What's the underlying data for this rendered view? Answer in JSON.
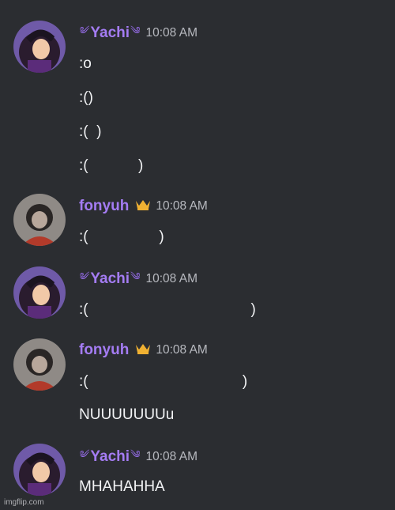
{
  "messages": [
    {
      "author": "Yachi",
      "author_type": "yachi",
      "decor_left": "༄",
      "decor_right": "༄",
      "time": "10:08 AM",
      "lines": [
        ":o",
        ":()",
        ":(  )",
        ":(            )"
      ]
    },
    {
      "author": "fonyuh",
      "author_type": "fonyuh",
      "time": "10:08 AM",
      "lines": [
        ":(                 )"
      ]
    },
    {
      "author": "Yachi",
      "author_type": "yachi",
      "decor_left": "༄",
      "decor_right": "༄",
      "time": "10:08 AM",
      "lines": [
        ":(                                       )"
      ]
    },
    {
      "author": "fonyuh",
      "author_type": "fonyuh",
      "time": "10:08 AM",
      "lines": [
        ":(                                     )",
        "NUUUUUUUu"
      ]
    },
    {
      "author": "Yachi",
      "author_type": "yachi",
      "decor_left": "༄",
      "decor_right": "༄",
      "time": "10:08 AM",
      "lines": [
        "MHAHAHHA"
      ]
    }
  ],
  "icons": {
    "crown": "crown-icon",
    "decor": "swirl-decoration-icon"
  },
  "colors": {
    "background": "#2b2d31",
    "username": "#a47cf3",
    "crown": "#f0b132",
    "timestamp": "#b7b9bf",
    "text": "#f2f3f5"
  },
  "watermark": "imgflip.com"
}
